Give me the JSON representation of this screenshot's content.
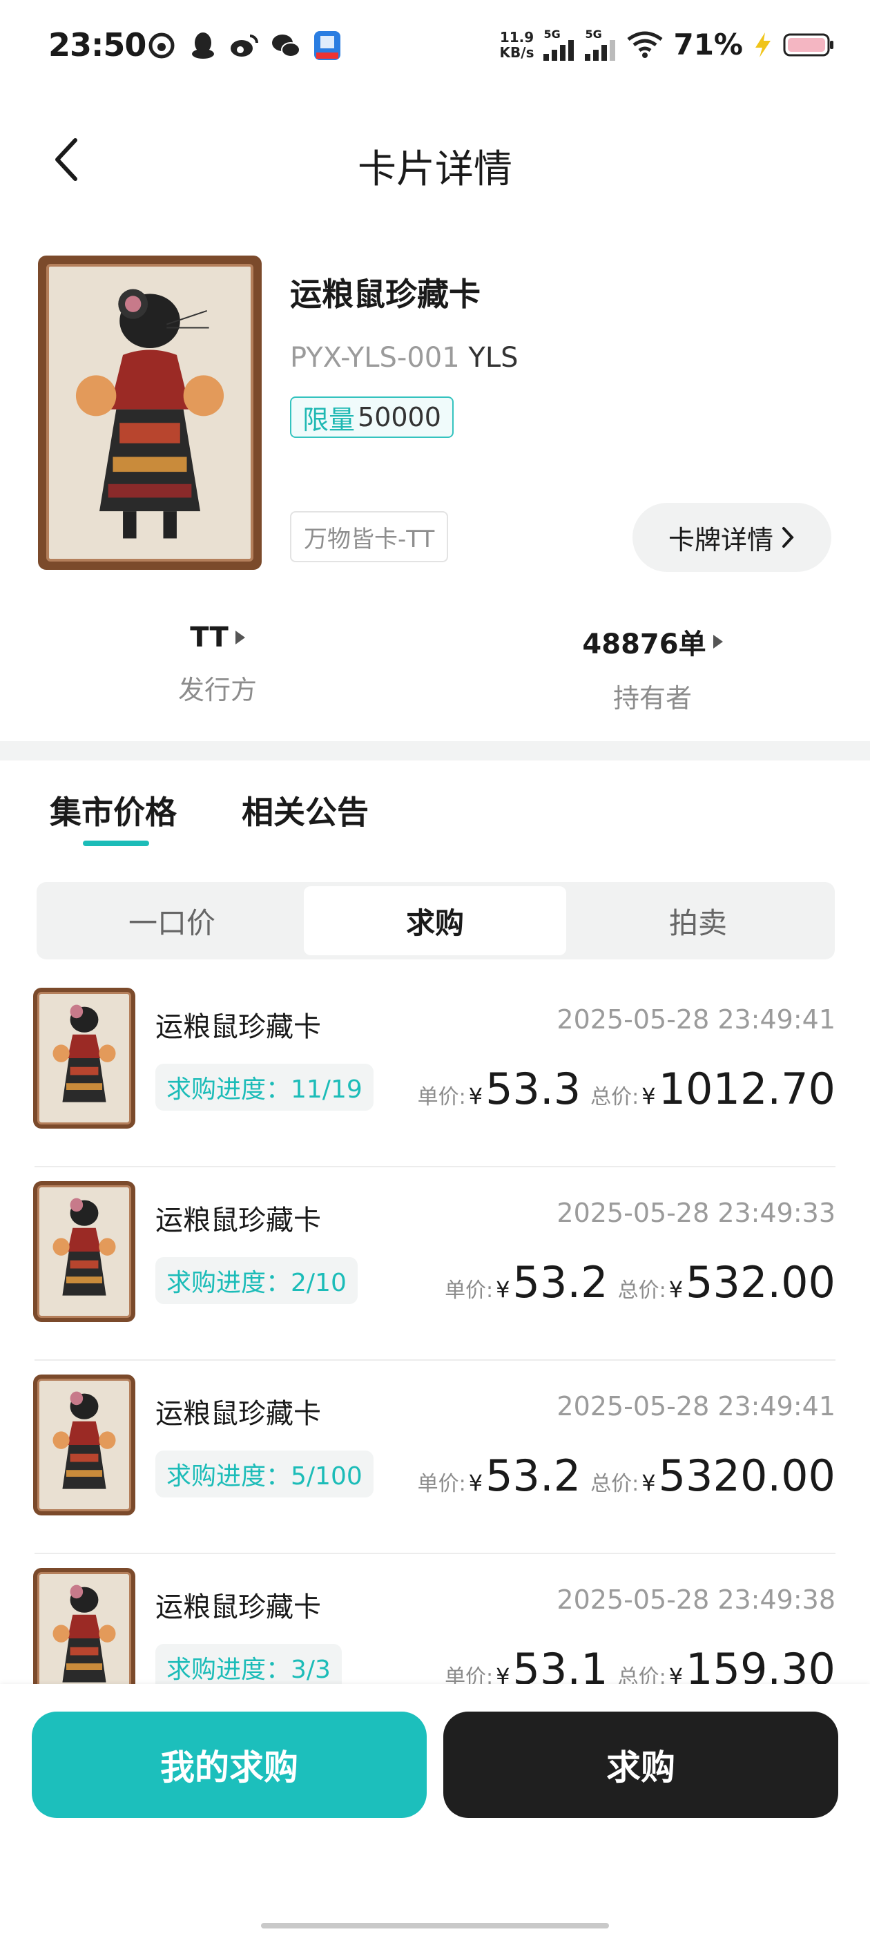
{
  "status_bar": {
    "time": "23:50",
    "net_speed_value": "11.9",
    "net_speed_unit": "KB/s",
    "signal_1": "5G",
    "signal_2": "5G",
    "battery": "71%",
    "app_icons": [
      "weibo-like-icon",
      "qq-icon",
      "weibo-icon",
      "wechat-icon",
      "finance-app-icon"
    ]
  },
  "header": {
    "title": "卡片详情"
  },
  "card": {
    "name": "运粮鼠珍藏卡",
    "code": "PYX-YLS-001",
    "code_suffix": "YLS",
    "limit_label": "限量",
    "limit_value": "50000",
    "series_tag": "万物皆卡-TT",
    "detail_button": "卡牌详情"
  },
  "meta": {
    "issuer_value": "TT",
    "issuer_label": "发行方",
    "holders_value": "48876单",
    "holders_label": "持有者"
  },
  "section_tabs": [
    "集市价格",
    "相关公告"
  ],
  "segment": [
    "一口价",
    "求购",
    "拍卖"
  ],
  "unit_price_label": "单价:",
  "total_price_label": "总价:",
  "currency": "¥",
  "orders": [
    {
      "title": "运粮鼠珍藏卡",
      "time": "2025-05-28 23:49:41",
      "progress": "求购进度：11/19",
      "unit_price": "53.3",
      "total_price": "1012.70"
    },
    {
      "title": "运粮鼠珍藏卡",
      "time": "2025-05-28 23:49:33",
      "progress": "求购进度：2/10",
      "unit_price": "53.2",
      "total_price": "532.00"
    },
    {
      "title": "运粮鼠珍藏卡",
      "time": "2025-05-28 23:49:41",
      "progress": "求购进度：5/100",
      "unit_price": "53.2",
      "total_price": "5320.00"
    },
    {
      "title": "运粮鼠珍藏卡",
      "time": "2025-05-28 23:49:38",
      "progress": "求购进度：3/3",
      "unit_price": "53.1",
      "total_price": "159.30"
    }
  ],
  "bottom": {
    "my_requests": "我的求购",
    "request": "求购"
  },
  "colors": {
    "accent": "#1cbfbc",
    "dark_button": "#1f1f1f"
  }
}
